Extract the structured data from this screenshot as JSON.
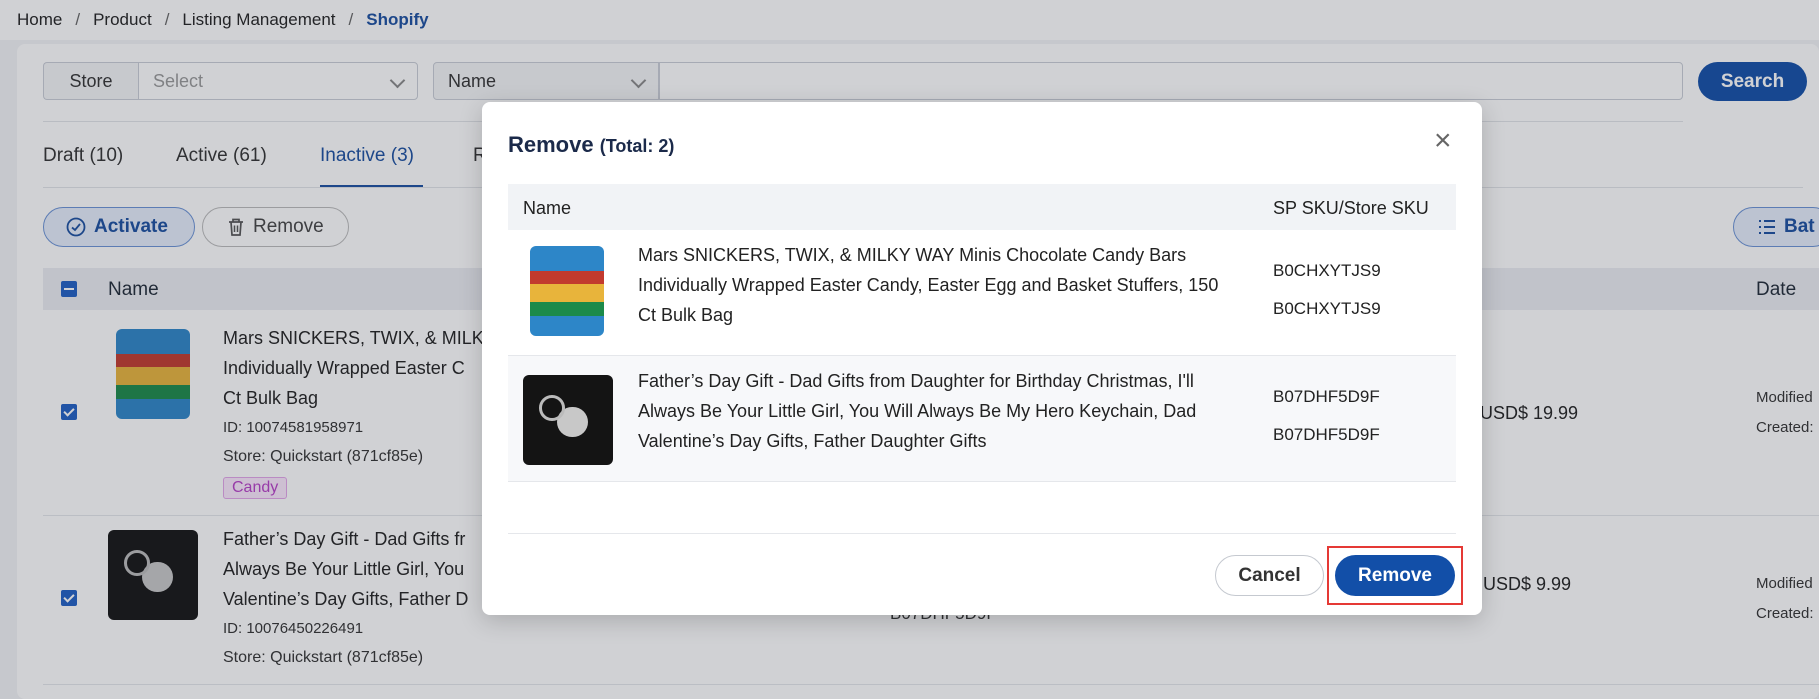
{
  "breadcrumb": {
    "home": "Home",
    "product": "Product",
    "listing": "Listing Management",
    "current": "Shopify"
  },
  "filters": {
    "store_label": "Store",
    "store_placeholder": "Select",
    "field_select": "Name",
    "search_label": "Search"
  },
  "tabs": [
    "Draft (10)",
    "Active (61)",
    "Inactive (3)",
    "R"
  ],
  "actions": {
    "activate": "Activate",
    "remove": "Remove",
    "batch": "Bat"
  },
  "table": {
    "col_name": "Name",
    "col_date": "Date",
    "rows": [
      {
        "title_lines": [
          "Mars SNICKERS, TWIX, & MILKY",
          "Individually Wrapped Easter C",
          "Ct Bulk Bag"
        ],
        "id": "ID: 10074581958971",
        "store": "Store: Quickstart (871cf85e)",
        "tag": "Candy",
        "price": "USD$ 19.99",
        "modified": "Modified",
        "created": "Created:"
      },
      {
        "title_lines": [
          "Father’s Day Gift - Dad Gifts fr",
          "Always Be Your Little Girl, You",
          "Valentine’s Day Gifts, Father D"
        ],
        "id": "ID: 10076450226491",
        "store": "Store: Quickstart (871cf85e)",
        "sku_partial": "B07DHF5D9F",
        "price": "USD$ 9.99",
        "modified": "Modified",
        "created": "Created:"
      }
    ]
  },
  "modal": {
    "title": "Remove",
    "total": "(Total: 2)",
    "col_name": "Name",
    "col_sku": "SP SKU/Store SKU",
    "items": [
      {
        "name": "Mars SNICKERS, TWIX, & MILKY WAY Minis Chocolate Candy Bars Individually Wrapped Easter Candy, Easter Egg and Basket Stuffers, 150 Ct Bulk Bag",
        "sp_sku": "B0CHXYTJS9",
        "store_sku": "B0CHXYTJS9"
      },
      {
        "name": "Father’s Day Gift - Dad Gifts from Daughter for Birthday Christmas, I'll Always Be Your Little Girl, You Will Always Be My Hero Keychain, Dad Valentine’s Day Gifts, Father Daughter Gifts",
        "sp_sku": "B07DHF5D9F",
        "store_sku": "B07DHF5D9F"
      }
    ],
    "cancel": "Cancel",
    "confirm": "Remove",
    "close_glyph": "×"
  }
}
